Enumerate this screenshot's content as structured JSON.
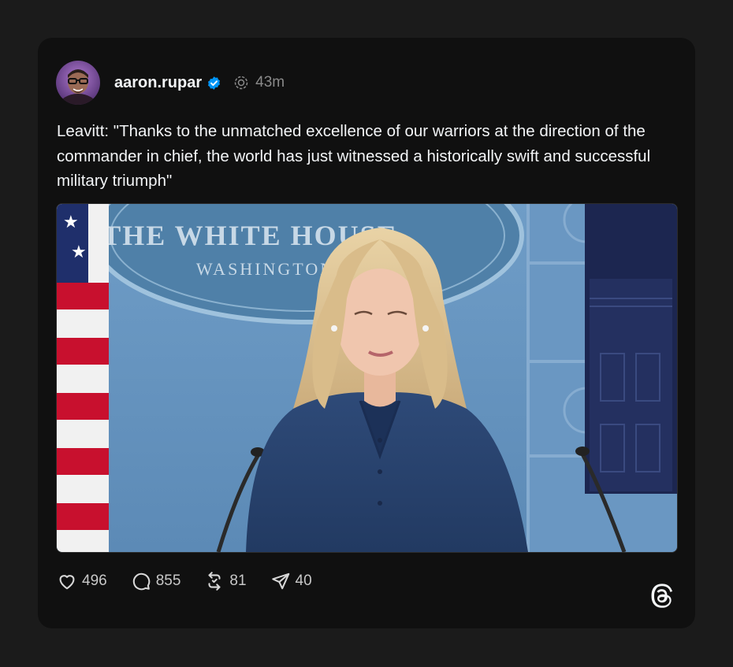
{
  "post": {
    "username": "aaron.rupar",
    "time": "43m",
    "text": "Leavitt: \"Thanks to the unmatched excellence of our warriors at the direction of the commander in chief, the world has just witnessed a historically swift and successful military triumph\"",
    "media": {
      "seal_line1": "THE WHITE HOUSE",
      "seal_line2": "WASHINGTON"
    }
  },
  "actions": {
    "likes": "496",
    "replies": "855",
    "reposts": "81",
    "shares": "40"
  },
  "colors": {
    "background": "#1b1b1b",
    "card": "#101010",
    "verified": "#0095f6",
    "text": "#f3f5f7",
    "muted": "#8a8a8a"
  },
  "icons": {
    "verified": "verified-badge-icon",
    "reply_status": "threads-reply-icon",
    "like": "heart-icon",
    "reply": "comment-icon",
    "repost": "repost-icon",
    "share": "send-icon",
    "brand": "threads-logo-icon"
  }
}
